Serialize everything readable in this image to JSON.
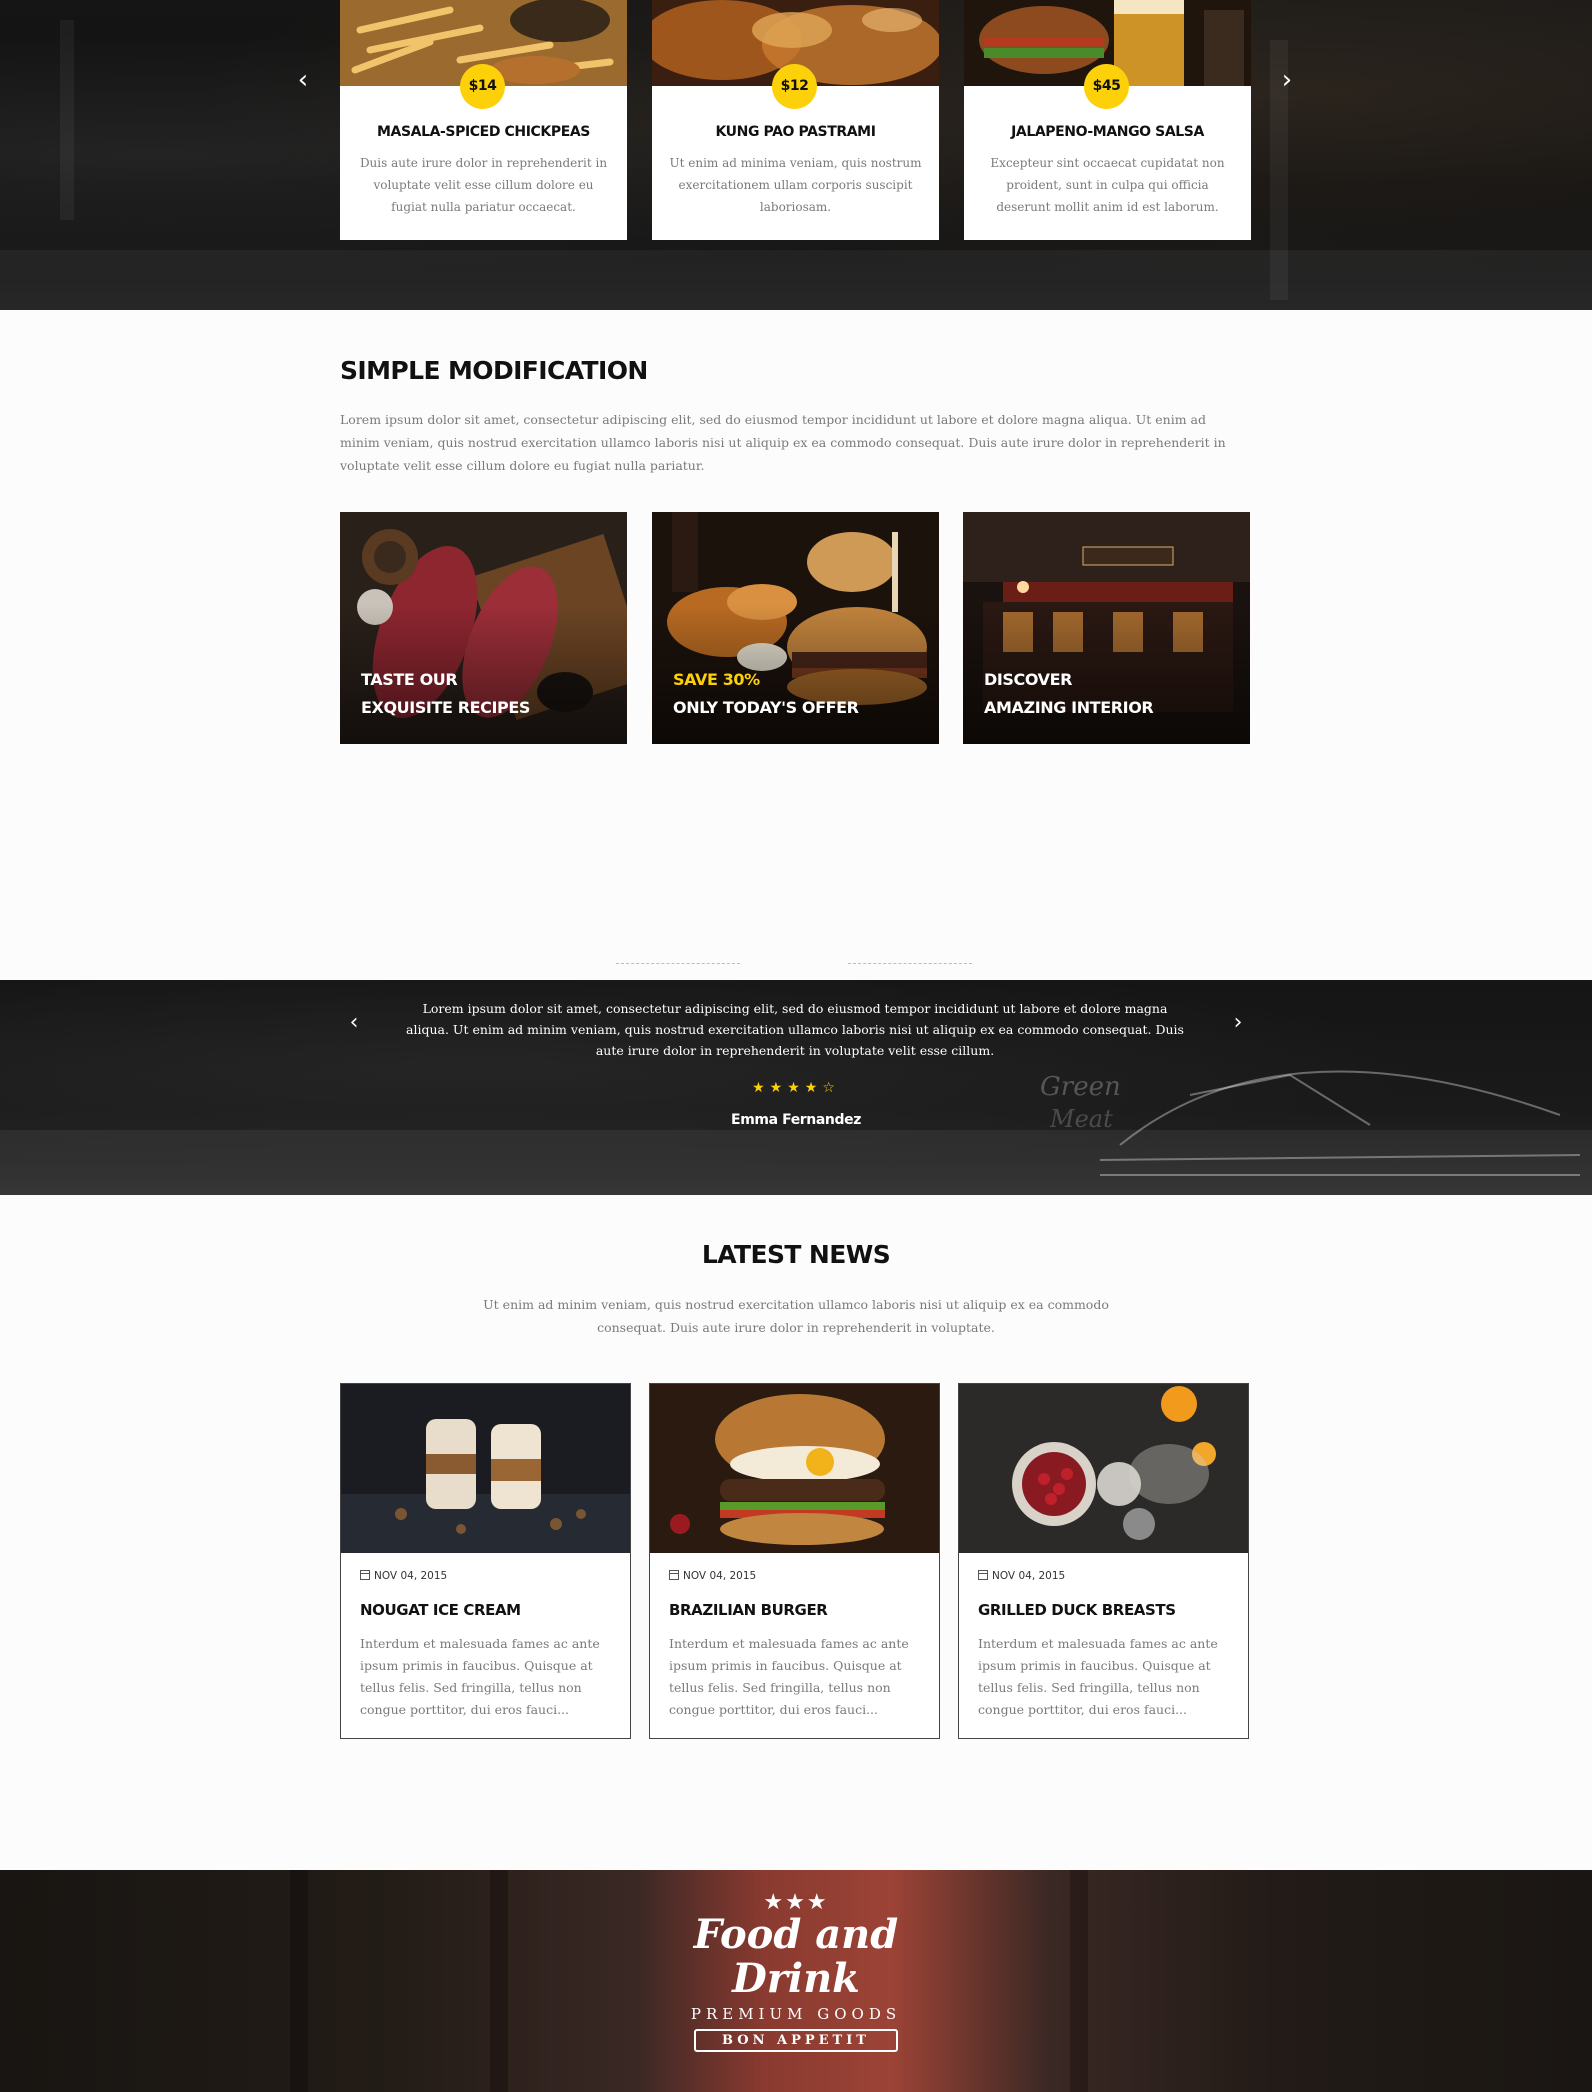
{
  "hero": {
    "prev_icon": "chevron-left-icon",
    "next_icon": "chevron-right-icon",
    "menu_items": [
      {
        "price": "$14",
        "name": "MASALA-SPICED CHICKPEAS",
        "description": "Duis aute irure dolor in reprehenderit in voluptate velit esse cillum dolore eu fugiat nulla pariatur occaecat."
      },
      {
        "price": "$12",
        "name": "KUNG PAO PASTRAMI",
        "description": "Ut enim ad minima veniam, quis nostrum exercitationem ullam corporis suscipit laboriosam."
      },
      {
        "price": "$45",
        "name": "JALAPENO-MANGO SALSA",
        "description": "Excepteur sint occaecat cupidatat non proident, sunt in culpa qui officia deserunt mollit anim id est laborum."
      }
    ]
  },
  "simple": {
    "title": "SIMPLE MODIFICATION",
    "text": "Lorem ipsum dolor sit amet, consectetur adipiscing elit, sed do eiusmod tempor incididunt ut labore et dolore magna aliqua. Ut enim ad minim veniam, quis nostrud exercitation ullamco laboris nisi ut aliquip ex ea commodo consequat. Duis aute irure dolor in reprehenderit in voluptate velit esse cillum dolore eu fugiat nulla pariatur.",
    "promos": [
      {
        "line1": "TASTE OUR",
        "line2": "EXQUISITE RECIPES"
      },
      {
        "line1": "SAVE 30%",
        "line2": "ONLY TODAY'S OFFER"
      },
      {
        "line1": "DISCOVER",
        "line2": "AMAZING INTERIOR"
      }
    ]
  },
  "testimonial": {
    "quote": "Lorem ipsum dolor sit amet, consectetur adipiscing elit, sed do eiusmod tempor incididunt ut labore et dolore magna aliqua. Ut enim ad minim veniam, quis nostrud exercitation ullamco laboris nisi ut aliquip ex ea commodo consequat. Duis aute irure dolor in reprehenderit in voluptate velit esse cillum.",
    "rating": 4,
    "rating_max": 5,
    "author": "Emma Fernandez"
  },
  "news": {
    "title": "LATEST NEWS",
    "intro": "Ut enim ad minim veniam, quis nostrud exercitation ullamco laboris nisi ut aliquip ex ea commodo consequat. Duis aute irure dolor in reprehenderit in voluptate.",
    "posts": [
      {
        "date": "NOV 04, 2015",
        "title": "NOUGAT ICE CREAM",
        "excerpt": "Interdum et malesuada fames ac ante ipsum primis in faucibus. Quisque at tellus felis. Sed fringilla, tellus non congue porttitor, dui eros fauci..."
      },
      {
        "date": "NOV 04, 2015",
        "title": "BRAZILIAN BURGER",
        "excerpt": "Interdum et malesuada fames ac ante ipsum primis in faucibus. Quisque at tellus felis. Sed fringilla, tellus non congue porttitor, dui eros fauci..."
      },
      {
        "date": "NOV 04, 2015",
        "title": "GRILLED DUCK BREASTS",
        "excerpt": "Interdum et malesuada fames ac ante ipsum primis in faucibus. Quisque at tellus felis. Sed fringilla, tellus non congue porttitor, dui eros fauci..."
      }
    ]
  },
  "footer": {
    "logo_stars": "★★★",
    "logo_title": "Food and Drink",
    "logo_subtitle": "PREMIUM GOODS",
    "logo_ribbon": "BON APPETIT"
  },
  "colors": {
    "accent": "#fdd10a",
    "dark": "#111111",
    "muted_text": "#7a7a7a"
  }
}
